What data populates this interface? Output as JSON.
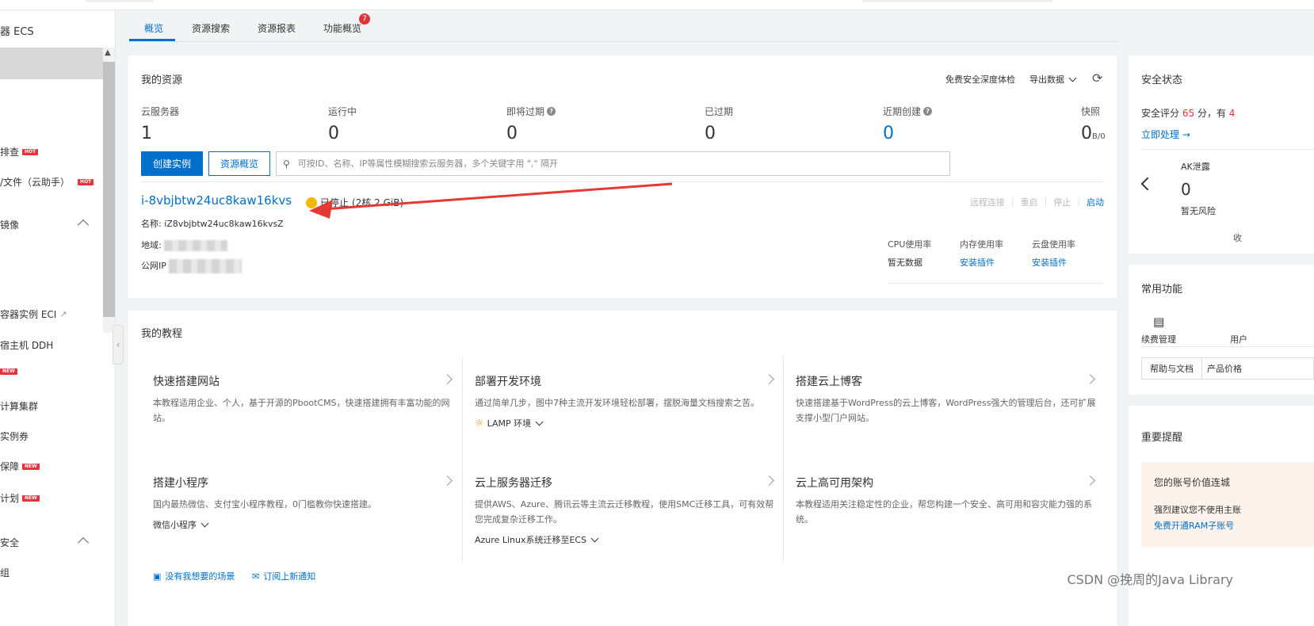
{
  "sidebar": {
    "title": "器 ECS",
    "items": [
      {
        "label": "排查",
        "badge": "HOT"
      },
      {
        "label": "/文件（云助手）",
        "badge": "HOT"
      },
      {
        "label": "镜像"
      },
      {
        "label": "容器实例 ECI"
      },
      {
        "label": "宿主机 DDH"
      },
      {
        "label": "",
        "badge": "NEW"
      },
      {
        "label": "计算集群"
      },
      {
        "label": "实例券"
      },
      {
        "label": "保障",
        "badge": "NEW"
      },
      {
        "label": "计划",
        "badge": "NEW"
      },
      {
        "label": "安全"
      },
      {
        "label": "组"
      }
    ]
  },
  "tabs": [
    {
      "label": "概览",
      "active": true
    },
    {
      "label": "资源搜索"
    },
    {
      "label": "资源报表"
    },
    {
      "label": "功能概览",
      "badge": "7"
    }
  ],
  "resources": {
    "title": "我的资源",
    "free_check": "免费安全深度体检",
    "export": "导出数据",
    "stats": [
      {
        "label": "云服务器",
        "value": "1"
      },
      {
        "label": "运行中",
        "value": "0"
      },
      {
        "label": "即将过期",
        "value": "0",
        "help": "?"
      },
      {
        "label": "已过期",
        "value": "0"
      },
      {
        "label": "近期创建",
        "value": "0",
        "help": "?"
      },
      {
        "label": "快照",
        "value": "0",
        "sub": "B/0"
      }
    ],
    "create_button": "创建实例",
    "overview_button": "资源概览",
    "search_placeholder": "可按ID、名称、IP等属性模糊搜索云服务器，多个关键字用 \",\" 隔开",
    "instance": {
      "id": "i-8vbjbtw24uc8kaw16kvs",
      "status": "已停止",
      "spec": "(2核 2 GiB)",
      "name_label": "名称:",
      "name_value": "iZ8vbjbtw24uc8kaw16kvsZ",
      "region_label": "地域:",
      "ip_label": "公网IP",
      "actions": [
        "远程连接",
        "重启",
        "停止",
        "启动"
      ],
      "metrics": [
        {
          "label": "CPU使用率",
          "value": "暂无数据"
        },
        {
          "label": "内存使用率",
          "value": "安装插件"
        },
        {
          "label": "云盘使用率",
          "value": "安装插件"
        }
      ]
    }
  },
  "tutorials": {
    "title": "我的教程",
    "items": [
      {
        "title": "快速搭建网站",
        "desc": "本教程适用企业、个人，基于开源的PbootCMS，快速搭建拥有丰富功能的网站。"
      },
      {
        "title": "部署开发环境",
        "desc": "通过简单几步，图中7种主流开发环境轻松部署，摆脱海量文档搜索之苦。",
        "sub": "LAMP 环境"
      },
      {
        "title": "搭建云上博客",
        "desc": "快速搭建基于WordPress的云上博客，WordPress强大的管理后台，还可扩展支撑小型门户网站。"
      },
      {
        "title": "搭建小程序",
        "desc": "国内最热微信、支付宝小程序教程，0门槛教你快速搭建。",
        "sub": "微信小程序"
      },
      {
        "title": "云上服务器迁移",
        "desc": "提供AWS、Azure、腾讯云等主流云迁移教程，使用SMC迁移工具，可有效帮您完成复杂迁移工作。",
        "sub": "Azure Linux系统迁移至ECS"
      },
      {
        "title": "云上高可用架构",
        "desc": "本教程适用关注稳定性的企业，帮您构建一个安全、高可用和容灾能力强的系统。"
      }
    ],
    "no_scene": "没有我想要的场景",
    "subscribe": "订阅上新通知"
  },
  "security": {
    "title": "安全状态",
    "score_prefix": "安全评分",
    "score": "65",
    "score_suffix": "分，有",
    "score_extra": "4",
    "handle": "立即处理 →",
    "ak_label": "AK泄露",
    "ak_value": "0",
    "ak_risk": "暂无风险",
    "collect": "收"
  },
  "common": {
    "title": "常用功能",
    "items": [
      "续费管理",
      "用户"
    ],
    "tabs": [
      "帮助与文档",
      "产品价格"
    ]
  },
  "notice": {
    "title": "重要提醒",
    "box_title": "您的账号价值连城",
    "box_text": "强烈建议您不使用主账",
    "box_link": "免费开通RAM子账号"
  },
  "watermark": "CSDN @挽周的Java Library",
  "colors": {
    "primary": "#0070cc",
    "danger": "#e8323c",
    "warning": "#f5b800",
    "arrow": "#e53935"
  }
}
